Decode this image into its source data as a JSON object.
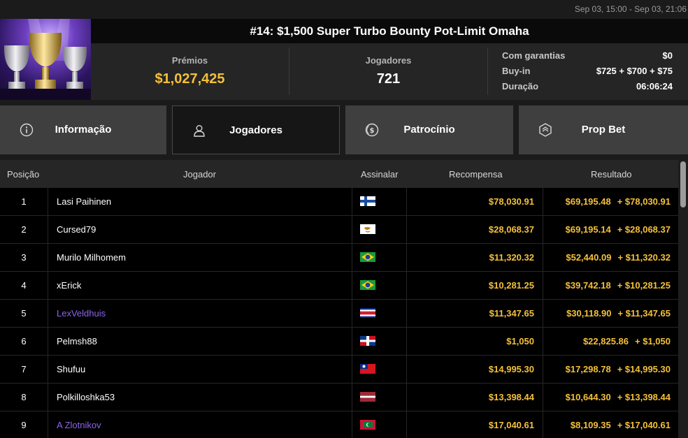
{
  "date_range": "Sep 03, 15:00 - Sep 03, 21:06",
  "tournament": {
    "title": "#14: $1,500 Super Turbo Bounty Pot-Limit Omaha"
  },
  "stats": {
    "prizes_label": "Prémios",
    "prizes_value": "$1,027,425",
    "players_label": "Jogadores",
    "players_value": "721"
  },
  "details": [
    {
      "key": "Com garantias",
      "value": "$0"
    },
    {
      "key": "Buy-in",
      "value": "$725 + $700 + $75"
    },
    {
      "key": "Duração",
      "value": "06:06:24"
    }
  ],
  "tabs": [
    {
      "label": "Informação",
      "icon": "info-icon",
      "active": false
    },
    {
      "label": "Jogadores",
      "icon": "user-icon",
      "active": true
    },
    {
      "label": "Patrocínio",
      "icon": "dollar-coin-icon",
      "active": false
    },
    {
      "label": "Prop Bet",
      "icon": "poker-chip-icon",
      "active": false
    }
  ],
  "table": {
    "columns": {
      "position": "Posição",
      "player": "Jogador",
      "flag": "Assinalar",
      "reward": "Recompensa",
      "result": "Resultado"
    },
    "rows": [
      {
        "pos": "1",
        "name": "Lasi Paihinen",
        "linked": false,
        "flag": "finland-flag-icon",
        "reward": "$78,030.91",
        "result_base": "$69,195.48",
        "result_add": "+ $78,030.91"
      },
      {
        "pos": "2",
        "name": "Cursed79",
        "linked": false,
        "flag": "cyprus-flag-icon",
        "reward": "$28,068.37",
        "result_base": "$69,195.14",
        "result_add": "+ $28,068.37"
      },
      {
        "pos": "3",
        "name": "Murilo Milhomem",
        "linked": false,
        "flag": "brazil-flag-icon",
        "reward": "$11,320.32",
        "result_base": "$52,440.09",
        "result_add": "+ $11,320.32"
      },
      {
        "pos": "4",
        "name": "xErick",
        "linked": false,
        "flag": "brazil-flag-icon",
        "reward": "$10,281.25",
        "result_base": "$39,742.18",
        "result_add": "+ $10,281.25"
      },
      {
        "pos": "5",
        "name": "LexVeldhuis",
        "linked": true,
        "flag": "costa-rica-flag-icon",
        "reward": "$11,347.65",
        "result_base": "$30,118.90",
        "result_add": "+ $11,347.65"
      },
      {
        "pos": "6",
        "name": "Pelmsh88",
        "linked": false,
        "flag": "dominican-republic-flag-icon",
        "reward": "$1,050",
        "result_base": "$22,825.86",
        "result_add": "+ $1,050"
      },
      {
        "pos": "7",
        "name": "Shufuu",
        "linked": false,
        "flag": "taiwan-flag-icon",
        "reward": "$14,995.30",
        "result_base": "$17,298.78",
        "result_add": "+ $14,995.30"
      },
      {
        "pos": "8",
        "name": "Polkilloshka53",
        "linked": false,
        "flag": "latvia-flag-icon",
        "reward": "$13,398.44",
        "result_base": "$10,644.30",
        "result_add": "+ $13,398.44"
      },
      {
        "pos": "9",
        "name": "A Zlotnikov",
        "linked": true,
        "flag": "maldives-flag-icon",
        "reward": "$17,040.61",
        "result_base": "$8,109.35",
        "result_add": "+ $17,040.61"
      }
    ]
  },
  "colors": {
    "gold": "#f4c03a",
    "link": "#8d63f0",
    "tab_bg": "#3f3f3f",
    "tab_active_bg": "#161616"
  }
}
